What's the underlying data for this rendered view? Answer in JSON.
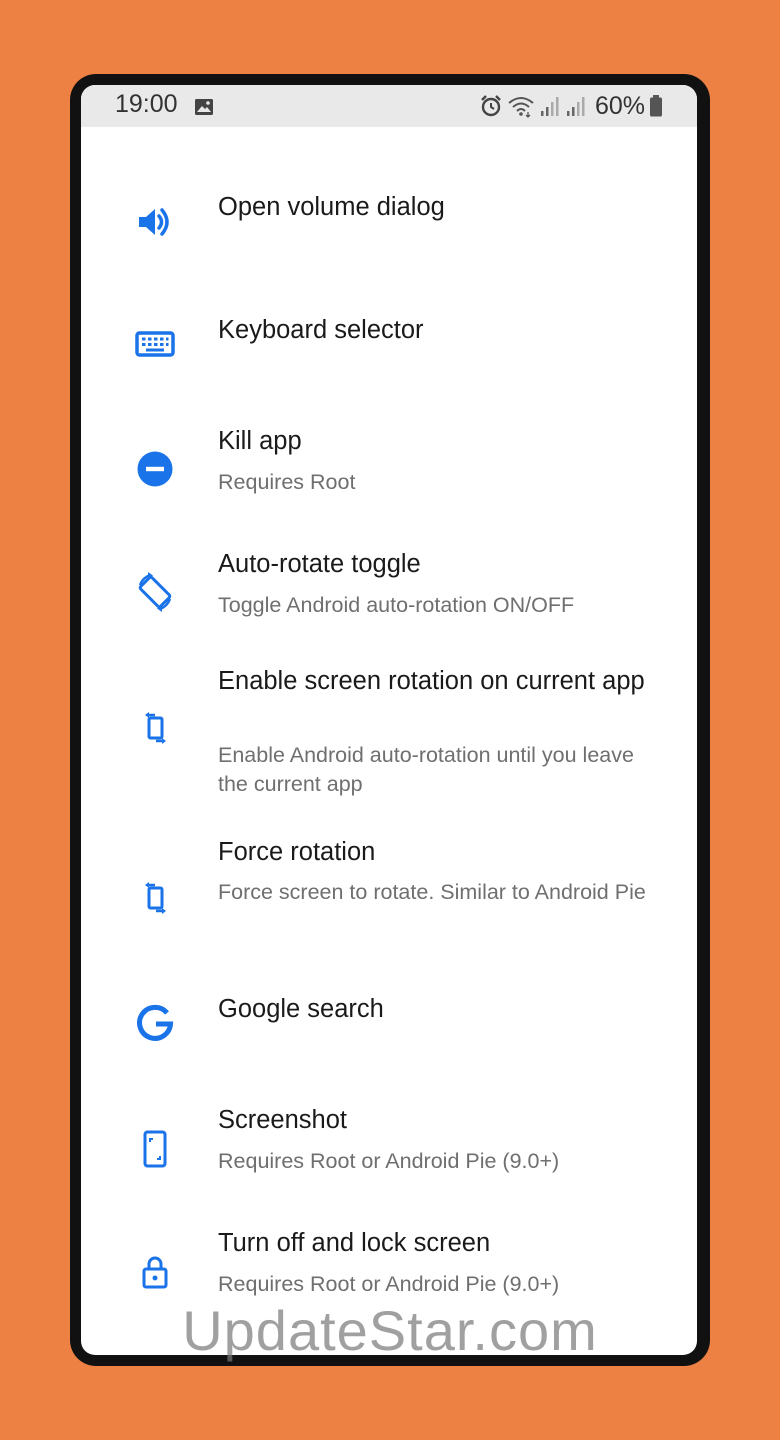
{
  "status_bar": {
    "time": "19:00",
    "battery": "60%",
    "icons": [
      "image-icon",
      "alarm-icon",
      "wifi-icon",
      "signal-icon",
      "signal-icon",
      "battery-icon"
    ]
  },
  "accent_color": "#1A73E8",
  "background_color": "#ED8043",
  "items": [
    {
      "icon": "volume-icon",
      "title": "Open volume dialog",
      "subtitle": ""
    },
    {
      "icon": "keyboard-icon",
      "title": "Keyboard selector",
      "subtitle": ""
    },
    {
      "icon": "minus-circle-icon",
      "title": "Kill app",
      "subtitle": "Requires Root"
    },
    {
      "icon": "auto-rotate-icon",
      "title": "Auto-rotate toggle",
      "subtitle": "Toggle Android auto-rotation ON/OFF"
    },
    {
      "icon": "screen-rotation-icon",
      "title": "Enable screen rotation on current app",
      "subtitle": "Enable Android auto-rotation until you leave the current app"
    },
    {
      "icon": "screen-rotation-icon",
      "title": "Force rotation",
      "subtitle": "Force screen to rotate. Similar to Android Pie"
    },
    {
      "icon": "google-icon",
      "title": "Google search",
      "subtitle": ""
    },
    {
      "icon": "screenshot-icon",
      "title": "Screenshot",
      "subtitle": "Requires Root or Android Pie (9.0+)"
    },
    {
      "icon": "lock-icon",
      "title": "Turn off and lock screen",
      "subtitle": "Requires Root or Android Pie (9.0+)"
    }
  ],
  "watermark": "UpdateStar.com"
}
